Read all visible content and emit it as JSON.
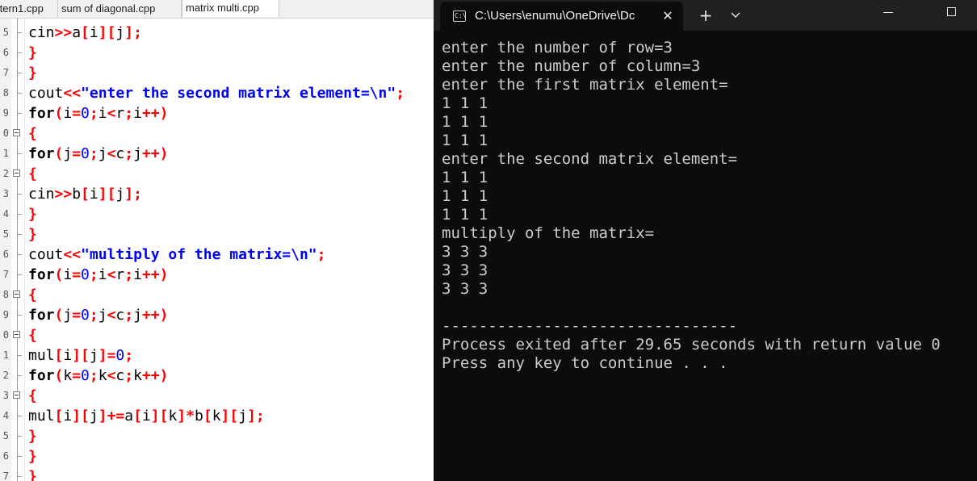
{
  "editor": {
    "tabs": [
      {
        "label": "ttern1.cpp",
        "active": false
      },
      {
        "label": "sum of diagonal.cpp",
        "active": false
      },
      {
        "label": "matrix multi.cpp",
        "active": true
      }
    ],
    "lines": [
      {
        "num": "5",
        "fold": false,
        "tokens": [
          {
            "t": "cin",
            "c": "id"
          },
          {
            "t": ">>",
            "c": "op"
          },
          {
            "t": "a",
            "c": "id"
          },
          {
            "t": "[",
            "c": "op"
          },
          {
            "t": "i",
            "c": "id"
          },
          {
            "t": "][",
            "c": "op"
          },
          {
            "t": "j",
            "c": "id"
          },
          {
            "t": "];",
            "c": "op"
          }
        ]
      },
      {
        "num": "6",
        "fold": false,
        "tokens": [
          {
            "t": "}",
            "c": "op"
          }
        ]
      },
      {
        "num": "7",
        "fold": false,
        "tokens": [
          {
            "t": "}",
            "c": "op"
          }
        ]
      },
      {
        "num": "8",
        "fold": false,
        "tokens": [
          {
            "t": "cout",
            "c": "id"
          },
          {
            "t": "<<",
            "c": "op"
          },
          {
            "t": "\"enter the second matrix element=\\n\"",
            "c": "str"
          },
          {
            "t": ";",
            "c": "op"
          }
        ]
      },
      {
        "num": "9",
        "fold": false,
        "tokens": [
          {
            "t": "for",
            "c": "kw"
          },
          {
            "t": "(",
            "c": "op"
          },
          {
            "t": "i",
            "c": "id"
          },
          {
            "t": "=",
            "c": "op"
          },
          {
            "t": "0",
            "c": "num"
          },
          {
            "t": ";",
            "c": "op"
          },
          {
            "t": "i",
            "c": "id"
          },
          {
            "t": "<",
            "c": "op"
          },
          {
            "t": "r",
            "c": "id"
          },
          {
            "t": ";",
            "c": "op"
          },
          {
            "t": "i",
            "c": "id"
          },
          {
            "t": "++)",
            "c": "op"
          }
        ]
      },
      {
        "num": "0",
        "fold": true,
        "tokens": [
          {
            "t": "{",
            "c": "op"
          }
        ]
      },
      {
        "num": "1",
        "fold": false,
        "tokens": [
          {
            "t": "for",
            "c": "kw"
          },
          {
            "t": "(",
            "c": "op"
          },
          {
            "t": "j",
            "c": "id"
          },
          {
            "t": "=",
            "c": "op"
          },
          {
            "t": "0",
            "c": "num"
          },
          {
            "t": ";",
            "c": "op"
          },
          {
            "t": "j",
            "c": "id"
          },
          {
            "t": "<",
            "c": "op"
          },
          {
            "t": "c",
            "c": "id"
          },
          {
            "t": ";",
            "c": "op"
          },
          {
            "t": "j",
            "c": "id"
          },
          {
            "t": "++)",
            "c": "op"
          }
        ]
      },
      {
        "num": "2",
        "fold": true,
        "tokens": [
          {
            "t": "{",
            "c": "op"
          }
        ]
      },
      {
        "num": "3",
        "fold": false,
        "tokens": [
          {
            "t": "cin",
            "c": "id"
          },
          {
            "t": ">>",
            "c": "op"
          },
          {
            "t": "b",
            "c": "id"
          },
          {
            "t": "[",
            "c": "op"
          },
          {
            "t": "i",
            "c": "id"
          },
          {
            "t": "][",
            "c": "op"
          },
          {
            "t": "j",
            "c": "id"
          },
          {
            "t": "];",
            "c": "op"
          }
        ]
      },
      {
        "num": "4",
        "fold": false,
        "tokens": [
          {
            "t": "}",
            "c": "op"
          }
        ]
      },
      {
        "num": "5",
        "fold": false,
        "tokens": [
          {
            "t": "}",
            "c": "op"
          }
        ]
      },
      {
        "num": "6",
        "fold": false,
        "tokens": [
          {
            "t": "cout",
            "c": "id"
          },
          {
            "t": "<<",
            "c": "op"
          },
          {
            "t": "\"multiply of the matrix=\\n\"",
            "c": "str"
          },
          {
            "t": ";",
            "c": "op"
          }
        ]
      },
      {
        "num": "7",
        "fold": false,
        "tokens": [
          {
            "t": "for",
            "c": "kw"
          },
          {
            "t": "(",
            "c": "op"
          },
          {
            "t": "i",
            "c": "id"
          },
          {
            "t": "=",
            "c": "op"
          },
          {
            "t": "0",
            "c": "num"
          },
          {
            "t": ";",
            "c": "op"
          },
          {
            "t": "i",
            "c": "id"
          },
          {
            "t": "<",
            "c": "op"
          },
          {
            "t": "r",
            "c": "id"
          },
          {
            "t": ";",
            "c": "op"
          },
          {
            "t": "i",
            "c": "id"
          },
          {
            "t": "++)",
            "c": "op"
          }
        ]
      },
      {
        "num": "8",
        "fold": true,
        "tokens": [
          {
            "t": "{",
            "c": "op"
          }
        ]
      },
      {
        "num": "9",
        "fold": false,
        "tokens": [
          {
            "t": "for",
            "c": "kw"
          },
          {
            "t": "(",
            "c": "op"
          },
          {
            "t": "j",
            "c": "id"
          },
          {
            "t": "=",
            "c": "op"
          },
          {
            "t": "0",
            "c": "num"
          },
          {
            "t": ";",
            "c": "op"
          },
          {
            "t": "j",
            "c": "id"
          },
          {
            "t": "<",
            "c": "op"
          },
          {
            "t": "c",
            "c": "id"
          },
          {
            "t": ";",
            "c": "op"
          },
          {
            "t": "j",
            "c": "id"
          },
          {
            "t": "++)",
            "c": "op"
          }
        ]
      },
      {
        "num": "0",
        "fold": true,
        "tokens": [
          {
            "t": "{",
            "c": "op"
          }
        ]
      },
      {
        "num": "1",
        "fold": false,
        "tokens": [
          {
            "t": "mul",
            "c": "id"
          },
          {
            "t": "[",
            "c": "op"
          },
          {
            "t": "i",
            "c": "id"
          },
          {
            "t": "][",
            "c": "op"
          },
          {
            "t": "j",
            "c": "id"
          },
          {
            "t": "]=",
            "c": "op"
          },
          {
            "t": "0",
            "c": "num"
          },
          {
            "t": ";",
            "c": "op"
          }
        ]
      },
      {
        "num": "2",
        "fold": false,
        "tokens": [
          {
            "t": "for",
            "c": "kw"
          },
          {
            "t": "(",
            "c": "op"
          },
          {
            "t": "k",
            "c": "id"
          },
          {
            "t": "=",
            "c": "op"
          },
          {
            "t": "0",
            "c": "num"
          },
          {
            "t": ";",
            "c": "op"
          },
          {
            "t": "k",
            "c": "id"
          },
          {
            "t": "<",
            "c": "op"
          },
          {
            "t": "c",
            "c": "id"
          },
          {
            "t": ";",
            "c": "op"
          },
          {
            "t": "k",
            "c": "id"
          },
          {
            "t": "++)",
            "c": "op"
          }
        ]
      },
      {
        "num": "3",
        "fold": true,
        "tokens": [
          {
            "t": "{",
            "c": "op"
          }
        ]
      },
      {
        "num": "4",
        "fold": false,
        "tokens": [
          {
            "t": "mul",
            "c": "id"
          },
          {
            "t": "[",
            "c": "op"
          },
          {
            "t": "i",
            "c": "id"
          },
          {
            "t": "][",
            "c": "op"
          },
          {
            "t": "j",
            "c": "id"
          },
          {
            "t": "]+=",
            "c": "op"
          },
          {
            "t": "a",
            "c": "id"
          },
          {
            "t": "[",
            "c": "op"
          },
          {
            "t": "i",
            "c": "id"
          },
          {
            "t": "][",
            "c": "op"
          },
          {
            "t": "k",
            "c": "id"
          },
          {
            "t": "]*",
            "c": "op"
          },
          {
            "t": "b",
            "c": "id"
          },
          {
            "t": "[",
            "c": "op"
          },
          {
            "t": "k",
            "c": "id"
          },
          {
            "t": "][",
            "c": "op"
          },
          {
            "t": "j",
            "c": "id"
          },
          {
            "t": "];",
            "c": "op"
          }
        ]
      },
      {
        "num": "5",
        "fold": false,
        "tokens": [
          {
            "t": "}",
            "c": "op"
          }
        ]
      },
      {
        "num": "6",
        "fold": false,
        "tokens": [
          {
            "t": "}",
            "c": "op"
          }
        ]
      },
      {
        "num": "7",
        "fold": false,
        "tokens": [
          {
            "t": "}",
            "c": "op"
          }
        ]
      }
    ]
  },
  "terminal": {
    "tab_title": "C:\\Users\\enumu\\OneDrive\\Dc",
    "icon_label": "C:\\",
    "close_glyph": "✕",
    "new_tab_glyph": "+",
    "output": [
      "enter the number of row=3",
      "enter the number of column=3",
      "enter the first matrix element=",
      "1 1 1",
      "1 1 1",
      "1 1 1",
      "enter the second matrix element=",
      "1 1 1",
      "1 1 1",
      "1 1 1",
      "multiply of the matrix=",
      "3 3 3",
      "3 3 3",
      "3 3 3",
      "",
      "--------------------------------",
      "Process exited after 29.65 seconds with return value 0",
      "Press any key to continue . . ."
    ]
  },
  "colors": {
    "keyword": "#000000",
    "operator": "#ff0000",
    "number": "#0000ff",
    "string": "#0000ff",
    "terminal_bg": "#0c0c0c",
    "terminal_fg": "#cccccc",
    "titlebar_bg": "#202020"
  }
}
